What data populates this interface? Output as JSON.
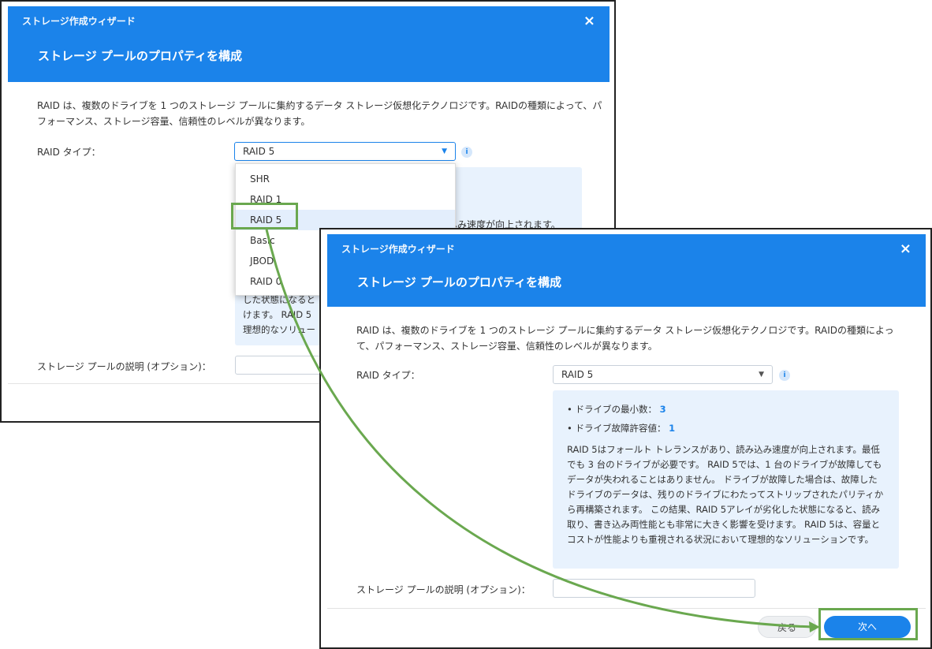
{
  "wizard_title": "ストレージ作成ウィザード",
  "dialog_title": "ストレージ プールのプロパティを構成",
  "description": "RAID は、複数のドライブを 1 つのストレージ プールに集約するデータ ストレージ仮想化テクノロジです。RAIDの種類によって、パフォーマンス、ストレージ容量、信頼性のレベルが異なります。",
  "raid_type_label": "RAID タイプ：",
  "raid_selected": "RAID 5",
  "raid_options": [
    "SHR",
    "RAID 1",
    "RAID 5",
    "Basic",
    "JBOD",
    "RAID 0"
  ],
  "info_icon": "i",
  "close_icon": "×",
  "caret_icon": "▼",
  "min_drives_label": "ドライブの最小数：",
  "min_drives_value": "3",
  "fault_tolerance_label": "ドライブ故障許容値：",
  "fault_tolerance_value": "1",
  "raid_description": "RAID 5はフォールト トレランスがあり、読み込み速度が向上されます。最低でも 3 台のドライブが必要です。 RAID 5では、1 台のドライブが故障してもデータが失われることはありません。 ドライブが故障した場合は、故障したドライブのデータは、残りのドライブにわたってストリップされたパリティから再構築されます。 この結果、RAID 5アレイが劣化した状態になると、読み取り、書き込み両性能とも非常に大きく影響を受けます。 RAID 5は、容量とコストが性能よりも重視される状況において理想的なソリューションです。",
  "partial_text": {
    "line1": "込み速度が向上されます。",
    "line2": "した状態になると",
    "line3": "けます。 RAID 5",
    "line4": "理想的なソリュー"
  },
  "pool_desc_label": "ストレージ プールの説明 (オプション)：",
  "back_button": "戻る",
  "next_button": "次へ",
  "colors": {
    "accent": "#1b83ea",
    "highlight": "#6aa84f",
    "panel": "#e8f2fd"
  }
}
